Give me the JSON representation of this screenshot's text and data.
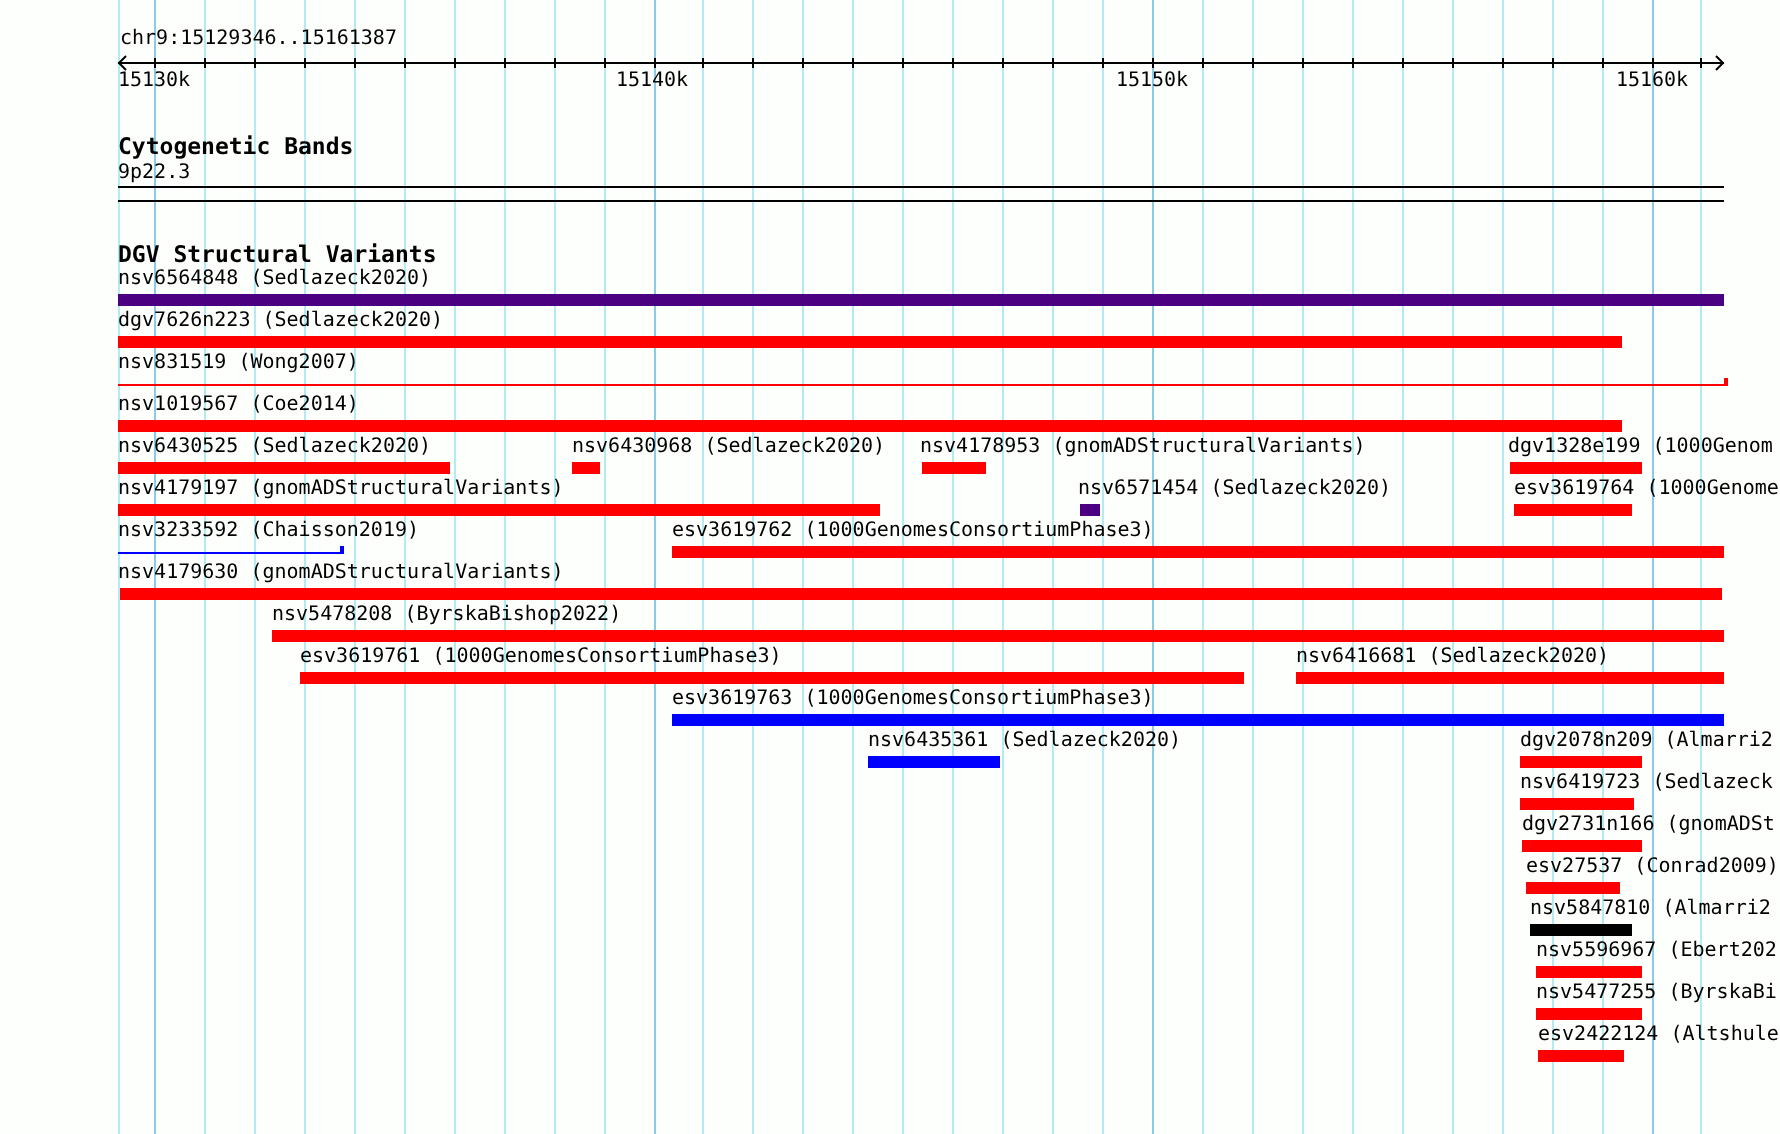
{
  "ruler": {
    "location": "chr9:15129346..15161387",
    "tick_labels": [
      "15130k",
      "15140k",
      "15150k",
      "15160k"
    ]
  },
  "tracks": [
    {
      "title": "Cytogenetic Bands",
      "kind": "bands",
      "features": [
        {
          "label": "9p22.3"
        }
      ]
    },
    {
      "title": "DGV Structural Variants",
      "kind": "variants",
      "features": [
        {
          "label": "nsv6564848 (Sedlazeck2020)",
          "color": "#4b0082",
          "kind": "bar"
        },
        {
          "label": "dgv7626n223 (Sedlazeck2020)",
          "color": "#ff0000",
          "kind": "bar"
        },
        {
          "label": "nsv831519 (Wong2007)",
          "color": "#ff0000",
          "kind": "line"
        },
        {
          "label": "nsv1019567 (Coe2014)",
          "color": "#ff0000",
          "kind": "bar"
        },
        {
          "label": "nsv6430525 (Sedlazeck2020)",
          "color": "#ff0000",
          "kind": "bar"
        },
        {
          "label": "nsv6430968 (Sedlazeck2020)",
          "color": "#ff0000",
          "kind": "bar"
        },
        {
          "label": "nsv4178953 (gnomADStructuralVariants)",
          "color": "#ff0000",
          "kind": "bar"
        },
        {
          "label": "dgv1328e199 (1000Genom",
          "color": "#ff0000",
          "kind": "bar"
        },
        {
          "label": "nsv4179197 (gnomADStructuralVariants)",
          "color": "#ff0000",
          "kind": "bar"
        },
        {
          "label": "nsv6571454 (Sedlazeck2020)",
          "color": "#4b0082",
          "kind": "bar"
        },
        {
          "label": "esv3619764 (1000Genome",
          "color": "#ff0000",
          "kind": "bar"
        },
        {
          "label": "nsv3233592 (Chaisson2019)",
          "color": "#0000ff",
          "kind": "line"
        },
        {
          "label": "esv3619762 (1000GenomesConsortiumPhase3)",
          "color": "#ff0000",
          "kind": "bar"
        },
        {
          "label": "nsv4179630 (gnomADStructuralVariants)",
          "color": "#ff0000",
          "kind": "bar"
        },
        {
          "label": "nsv5478208 (ByrskaBishop2022)",
          "color": "#ff0000",
          "kind": "bar"
        },
        {
          "label": "esv3619761 (1000GenomesConsortiumPhase3)",
          "color": "#ff0000",
          "kind": "bar"
        },
        {
          "label": "nsv6416681 (Sedlazeck2020)",
          "color": "#ff0000",
          "kind": "bar"
        },
        {
          "label": "esv3619763 (1000GenomesConsortiumPhase3)",
          "color": "#0000ff",
          "kind": "bar"
        },
        {
          "label": "nsv6435361 (Sedlazeck2020)",
          "color": "#0000ff",
          "kind": "bar"
        },
        {
          "label": "dgv2078n209 (Almarri2",
          "color": "#ff0000",
          "kind": "bar"
        },
        {
          "label": "nsv6419723 (Sedlazeck",
          "color": "#ff0000",
          "kind": "bar"
        },
        {
          "label": "dgv2731n166 (gnomADSt",
          "color": "#ff0000",
          "kind": "bar"
        },
        {
          "label": "esv27537 (Conrad2009)",
          "color": "#ff0000",
          "kind": "bar"
        },
        {
          "label": "nsv5847810 (Almarri2",
          "color": "#000000",
          "kind": "bar"
        },
        {
          "label": "nsv5596967 (Ebert202",
          "color": "#ff0000",
          "kind": "bar"
        },
        {
          "label": "nsv5477255 (ByrskaBi",
          "color": "#ff0000",
          "kind": "bar"
        },
        {
          "label": "esv2422124 (Altshule",
          "color": "#ff0000",
          "kind": "bar"
        }
      ]
    }
  ]
}
